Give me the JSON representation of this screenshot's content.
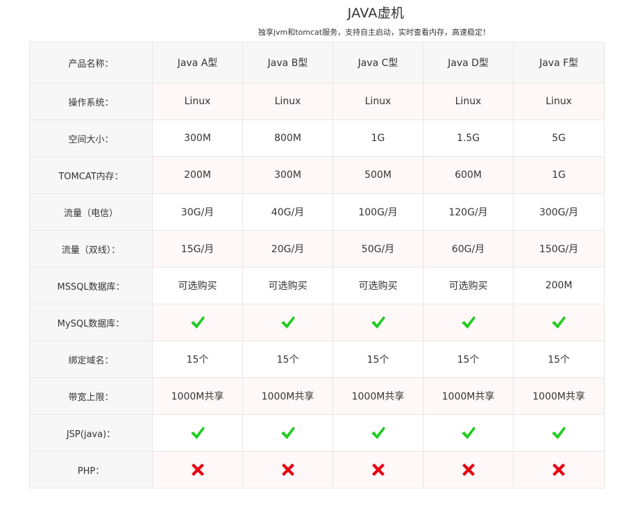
{
  "title": "JAVA虚机",
  "subtitle": "独享jvm和tomcat服务，支持自主启动，实时查看内存，高速稳定！",
  "colors": {
    "check": "#22cc22",
    "cross": "#e60012",
    "label_bg": "#f7f7f7",
    "alt_row_bg": "#fff8f8",
    "border": "#e6e6e6"
  },
  "header": {
    "label": "产品名称：",
    "plans": [
      "Java A型",
      "Java B型",
      "Java C型",
      "Java D型",
      "Java F型"
    ]
  },
  "rows": [
    {
      "label": "操作系统：",
      "values": [
        "Linux",
        "Linux",
        "Linux",
        "Linux",
        "Linux"
      ]
    },
    {
      "label": "空间大小：",
      "values": [
        "300M",
        "800M",
        "1G",
        "1.5G",
        "5G"
      ]
    },
    {
      "label": "TOMCAT内存：",
      "values": [
        "200M",
        "300M",
        "500M",
        "600M",
        "1G"
      ]
    },
    {
      "label": "流量（电信）",
      "values": [
        "30G/月",
        "40G/月",
        "100G/月",
        "120G/月",
        "300G/月"
      ]
    },
    {
      "label": "流量（双线）：",
      "values": [
        "15G/月",
        "20G/月",
        "50G/月",
        "60G/月",
        "150G/月"
      ]
    },
    {
      "label": "MSSQL数据库：",
      "values": [
        "可选购买",
        "可选购买",
        "可选购买",
        "可选购买",
        "200M"
      ]
    },
    {
      "label": "MySQL数据库：",
      "icons": [
        "check-icon",
        "check-icon",
        "check-icon",
        "check-icon",
        "check-icon"
      ]
    },
    {
      "label": "绑定域名：",
      "values": [
        "15个",
        "15个",
        "15个",
        "15个",
        "15个"
      ]
    },
    {
      "label": "带宽上限：",
      "values": [
        "1000M共享",
        "1000M共享",
        "1000M共享",
        "1000M共享",
        "1000M共享"
      ]
    },
    {
      "label": "JSP(java)：",
      "icons": [
        "check-icon",
        "check-icon",
        "check-icon",
        "check-icon",
        "check-icon"
      ]
    },
    {
      "label": "PHP：",
      "icons": [
        "cross-icon",
        "cross-icon",
        "cross-icon",
        "cross-icon",
        "cross-icon"
      ]
    }
  ]
}
